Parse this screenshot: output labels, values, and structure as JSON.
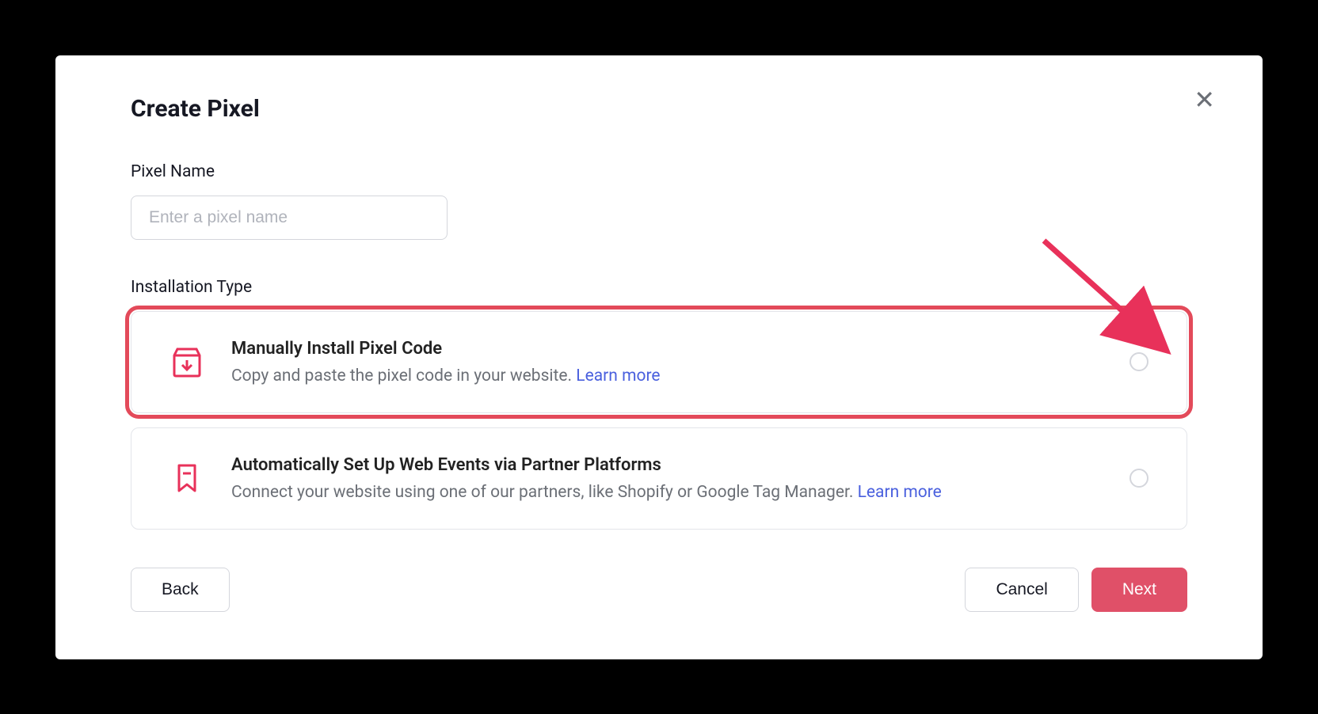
{
  "modal": {
    "title": "Create Pixel",
    "pixelName": {
      "label": "Pixel Name",
      "placeholder": "Enter a pixel name",
      "value": ""
    },
    "installationType": {
      "label": "Installation Type",
      "options": [
        {
          "title": "Manually Install Pixel Code",
          "description": "Copy and paste the pixel code in your website. ",
          "learnMore": "Learn more",
          "icon": "download-box-icon",
          "highlighted": true
        },
        {
          "title": "Automatically Set Up Web Events via Partner Platforms",
          "description": "Connect your website using one of our partners, like Shopify or Google Tag Manager. ",
          "learnMore": "Learn more",
          "icon": "bookmark-icon",
          "highlighted": false
        }
      ]
    },
    "buttons": {
      "back": "Back",
      "cancel": "Cancel",
      "next": "Next"
    }
  }
}
